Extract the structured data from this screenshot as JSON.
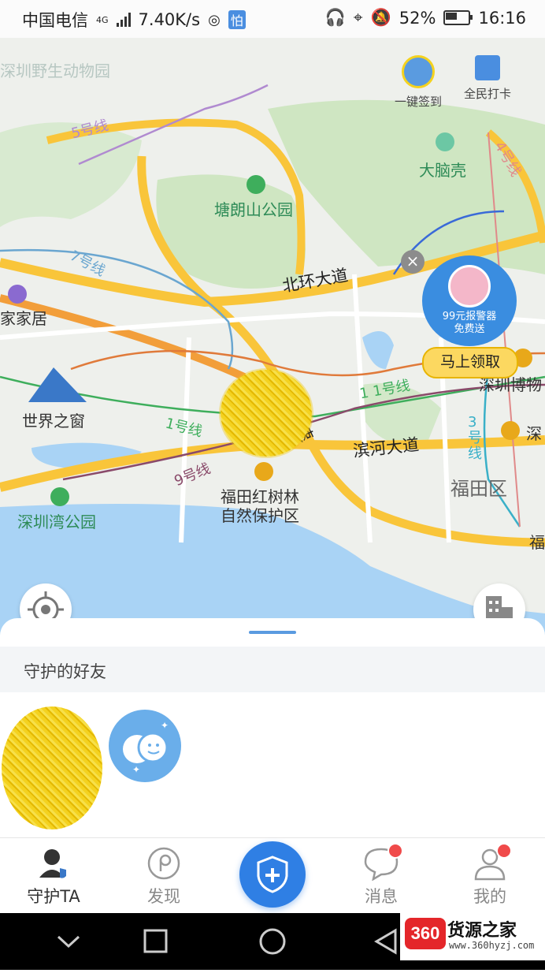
{
  "status_bar": {
    "carrier": "中国电信",
    "net_type": "4G",
    "speed": "7.40K/s",
    "app_badge": "怕",
    "battery": "52%",
    "time": "16:16"
  },
  "map": {
    "actions": [
      {
        "label": "一键签到",
        "icon": "check-in-icon"
      },
      {
        "label": "全民打卡",
        "icon": "calendar-check-icon"
      }
    ],
    "labels": {
      "wildlife_park": "深圳野生动物园",
      "line5": "5号线",
      "dananke": "大脑壳",
      "line4": "4号线",
      "tanglang": "塘朗山公园",
      "line7": "7号线",
      "beihuan": "北环大道",
      "jiajiaju": "家家居",
      "window_world": "世界之窗",
      "line1": "1号线",
      "line11": "1 1号线",
      "gaosu": "高速",
      "binhe": "滨河大道",
      "line9": "9号线",
      "museum": "深圳博物",
      "line3": "3号线",
      "shen": "深",
      "futian_district": "福田区",
      "mangrove": "福田红树林",
      "mangrove2": "自然保护区",
      "bay_park": "深圳湾公园",
      "fu": "福"
    },
    "promo": {
      "line1": "99元报警器",
      "line2": "免费送",
      "button": "马上领取",
      "close": "×"
    }
  },
  "sheet": {
    "section_title": "守护的好友"
  },
  "bottom_nav": {
    "items": [
      {
        "label": "守护TA",
        "icon": "guard-user-icon",
        "active": true
      },
      {
        "label": "发现",
        "icon": "discover-icon",
        "active": false
      },
      {
        "label": "消息",
        "icon": "message-icon",
        "badge": true
      },
      {
        "label": "我的",
        "icon": "profile-icon",
        "badge": true
      }
    ],
    "center": {
      "icon": "shield-plus-icon"
    }
  },
  "watermark": {
    "logo": "360",
    "name": "货源之家",
    "url": "www.360hyzj.com"
  },
  "colors": {
    "accent": "#2f7fe4",
    "highway": "#f9c53a",
    "badge": "#f04a4a",
    "promo_button": "#fcd860"
  }
}
